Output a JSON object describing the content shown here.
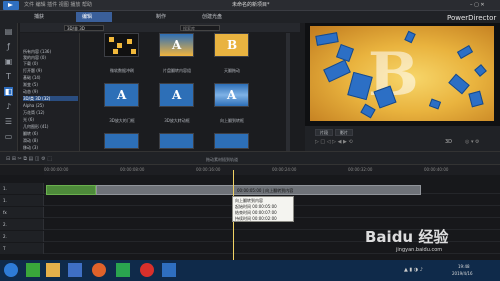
{
  "app": {
    "title": "未命名的新项目*",
    "brand": "PowerDirector"
  },
  "modes": [
    "捕获",
    "编辑",
    "制作",
    "创建光盘"
  ],
  "library": {
    "dropdown": "3D/非 3D",
    "search_placeholder": "搜索库",
    "tree": [
      "所有内容 (136)",
      "我的内容 (0)",
      "下载 (0)",
      "打开题 (9)",
      "基础 (14)",
      "渐变 (5)",
      "动态 (9)",
      "3D/类 3D (32)",
      "Alpha (25)",
      "万花筒 (12)",
      "光 (6)",
      "几何图形 (41)",
      "翻转 (6)",
      "滑动 (8)",
      "移动 (3)"
    ],
    "thumbs": [
      "微软数据冲刷",
      "片盘翻转内容组",
      "天翻拖动",
      "3D放大的门框",
      "3D放大转动框",
      "向上翻到转框"
    ]
  },
  "preview": {
    "toggle": [
      "片段",
      "影片"
    ],
    "mode_label": "3D"
  },
  "timeline": {
    "hint": "拖动素材插到轨道",
    "ruler": [
      "00:00:00:00",
      "00:00:08:00",
      "00:00:16:00",
      "00:00:24:00",
      "00:00:32:00",
      "00:00:40:00",
      "00:00:48:00"
    ],
    "tracks": [
      "1.",
      "1.",
      "fx",
      "2.",
      "2.",
      "T",
      "♪"
    ],
    "clip2_label": "00:00:05:00 | 向上翻转到内容",
    "tooltip": [
      "向上翻转到内容",
      "起始时间 00:00:05:00",
      "结束时间 00:00:07:00",
      "持续时间 00:00:02:00"
    ]
  },
  "taskbar": {
    "time": "19:48",
    "date": "2019/4/16"
  },
  "watermark": "Baidu 经验",
  "watermark_url": "jingyan.baidu.com",
  "colors": {
    "accent": "#2f6fc0",
    "clip_green": "#4d8a3a",
    "playhead": "#f0d264"
  }
}
